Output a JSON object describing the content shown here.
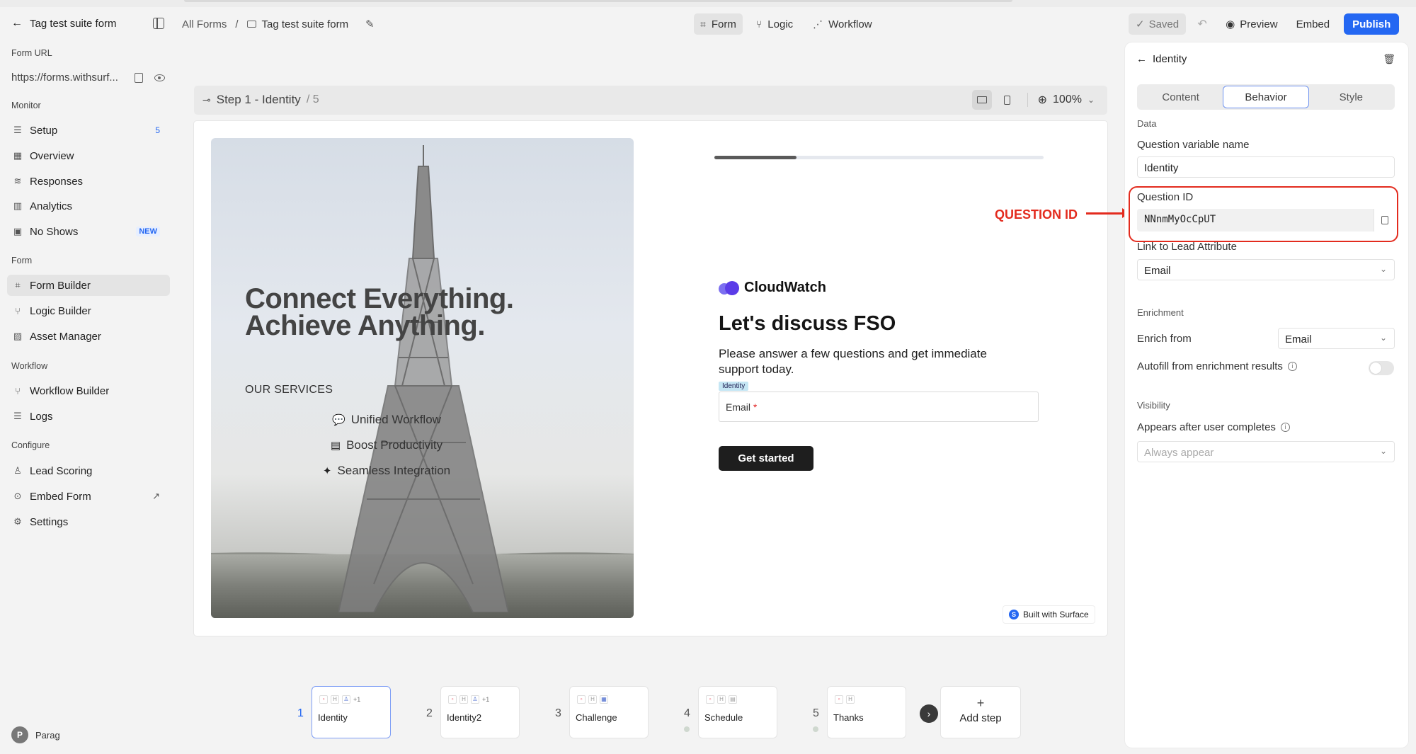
{
  "header": {
    "form_title": "Tag test suite form",
    "breadcrumb_root": "All Forms",
    "breadcrumb_sep": "/",
    "breadcrumb_current": "Tag test suite form",
    "modes": [
      {
        "label": "Form",
        "icon": "form-frame-icon",
        "active": true
      },
      {
        "label": "Logic",
        "icon": "logic-branch-icon",
        "active": false
      },
      {
        "label": "Workflow",
        "icon": "workflow-nodes-icon",
        "active": false
      }
    ],
    "saved_label": "Saved",
    "preview_label": "Preview",
    "embed_label": "Embed",
    "publish_label": "Publish",
    "publish_color": "#2467f2"
  },
  "sidebar": {
    "form_url_label": "Form URL",
    "form_url": "https://forms.withsurf...",
    "sections": {
      "monitor": "Monitor",
      "form": "Form",
      "workflow": "Workflow",
      "configure": "Configure"
    },
    "monitor_items": [
      {
        "label": "Setup",
        "badge": "5"
      },
      {
        "label": "Overview"
      },
      {
        "label": "Responses"
      },
      {
        "label": "Analytics"
      },
      {
        "label": "No Shows",
        "badge": "NEW"
      }
    ],
    "form_items": [
      {
        "label": "Form Builder",
        "active": true
      },
      {
        "label": "Logic Builder"
      },
      {
        "label": "Asset Manager"
      }
    ],
    "workflow_items": [
      {
        "label": "Workflow Builder"
      },
      {
        "label": "Logs"
      }
    ],
    "configure_items": [
      {
        "label": "Lead Scoring"
      },
      {
        "label": "Embed Form"
      },
      {
        "label": "Settings"
      }
    ],
    "user": {
      "initial": "P",
      "name": "Parag"
    }
  },
  "stepbar": {
    "step_label": "Step 1 - Identity",
    "step_total": "/ 5",
    "zoom": "100%"
  },
  "preview": {
    "hero_line1": "Connect Everything.",
    "hero_line2": "Achieve Anything.",
    "services_heading": "OUR SERVICES",
    "services": [
      {
        "label": "Unified Workflow",
        "icon": "chat-bubbles-icon"
      },
      {
        "label": "Boost Productivity",
        "icon": "calendar-icon"
      },
      {
        "label": "Seamless Integration",
        "icon": "sparkle-icon"
      }
    ],
    "progress_fraction": 0.25,
    "brand": "CloudWatch",
    "title": "Let's discuss FSO",
    "subtitle": "Please answer a few questions and get immediate support today.",
    "question_tag": "Identity",
    "email_placeholder": "Email",
    "required_mark": "*",
    "cta": "Get started",
    "built_with": "Built with Surface"
  },
  "annotation": {
    "label": "QUESTION ID",
    "color": "#e32b1e"
  },
  "panel": {
    "title": "Identity",
    "tabs": [
      {
        "label": "Content",
        "active": false
      },
      {
        "label": "Behavior",
        "active": true
      },
      {
        "label": "Style",
        "active": false
      }
    ],
    "data_section": "Data",
    "variable_label": "Question variable name",
    "variable_value": "Identity",
    "question_id_label": "Question ID",
    "question_id_value": "NNnmMyOcCpUT",
    "lead_attr_label": "Link to Lead Attribute",
    "lead_attr_value": "Email",
    "enrichment_section": "Enrichment",
    "enrich_from_label": "Enrich from",
    "enrich_from_value": "Email",
    "autofill_label": "Autofill from enrichment results",
    "autofill_on": false,
    "visibility_section": "Visibility",
    "appears_label": "Appears after user completes",
    "appears_placeholder": "Always appear"
  },
  "steps": [
    {
      "num": "1",
      "name": "Identity",
      "chips": [
        "form",
        "H",
        "user",
        "+1"
      ],
      "active": true
    },
    {
      "num": "2",
      "name": "Identity2",
      "chips": [
        "form",
        "H",
        "user",
        "+1"
      ]
    },
    {
      "num": "3",
      "name": "Challenge",
      "chips": [
        "form",
        "H",
        "grid"
      ]
    },
    {
      "num": "4",
      "name": "Schedule",
      "chips": [
        "form",
        "H",
        "calendar"
      ]
    },
    {
      "num": "5",
      "name": "Thanks",
      "chips": [
        "form",
        "H"
      ]
    }
  ],
  "add_step_label": "Add step"
}
